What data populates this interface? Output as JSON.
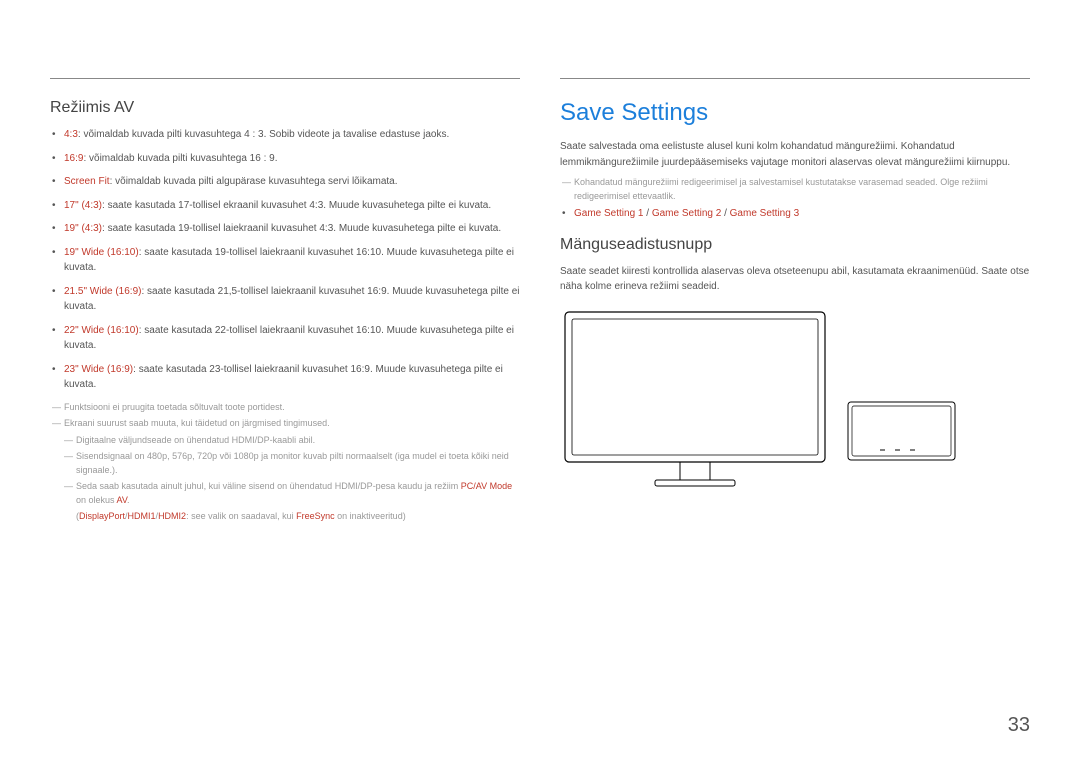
{
  "left": {
    "heading": "Režiimis AV",
    "bullets": [
      {
        "term": "4:3",
        "text": ": võimaldab kuvada pilti kuvasuhtega 4 : 3. Sobib videote ja tavalise edastuse jaoks."
      },
      {
        "term": "16:9",
        "text": ": võimaldab kuvada pilti kuvasuhtega 16 : 9."
      },
      {
        "term": "Screen Fit",
        "text": ": võimaldab kuvada pilti algupärase kuvasuhtega servi lõikamata."
      },
      {
        "term": "17\" (4:3)",
        "text": ": saate kasutada 17-tollisel ekraanil kuvasuhet 4:3. Muude kuvasuhetega pilte ei kuvata."
      },
      {
        "term": "19\" (4:3)",
        "text": ": saate kasutada 19-tollisel laiekraanil kuvasuhet 4:3. Muude kuvasuhetega pilte ei kuvata."
      },
      {
        "term": "19\" Wide (16:10)",
        "text": ": saate kasutada 19-tollisel laiekraanil kuvasuhet 16:10. Muude kuvasuhetega pilte ei kuvata."
      },
      {
        "term": "21.5\" Wide (16:9)",
        "text": ": saate kasutada 21,5-tollisel laiekraanil kuvasuhet 16:9. Muude kuvasuhetega pilte ei kuvata."
      },
      {
        "term": "22\" Wide (16:10)",
        "text": ": saate kasutada 22-tollisel laiekraanil kuvasuhet 16:10. Muude kuvasuhetega pilte ei kuvata."
      },
      {
        "term": "23\" Wide (16:9)",
        "text": ": saate kasutada 23-tollisel laiekraanil kuvasuhet 16:9. Muude kuvasuhetega pilte ei kuvata."
      }
    ],
    "note1": "Funktsiooni ei pruugita toetada sõltuvalt toote portidest.",
    "note2": "Ekraani suurust saab muuta, kui täidetud on järgmised tingimused.",
    "note2a": "Digitaalne väljundseade on ühendatud HDMI/DP-kaabli abil.",
    "note2b": "Sisendsignaal on 480p, 576p, 720p või 1080p ja monitor kuvab pilti normaalselt (iga mudel ei toeta kõiki neid signaale.).",
    "note2c_pre": "Seda saab kasutada ainult juhul, kui väline sisend on ühendatud HDMI/DP-pesa kaudu ja režiim ",
    "note2c_pcav": "PC/AV Mode",
    "note2c_mid": " on olekus ",
    "note2c_av": "AV",
    "note2c_post": ".",
    "note2d_open": "(",
    "note2d_dp": "DisplayPort",
    "note2d_h1": "HDMI1",
    "note2d_h2": "HDMI2",
    "note2d_mid": ": see valik on saadaval, kui ",
    "note2d_fs": "FreeSync",
    "note2d_end": " on inaktiveeritud)"
  },
  "right": {
    "heading": "Save Settings",
    "para1": "Saate salvestada oma eelistuste alusel kuni kolm kohandatud mängurežiimi. Kohandatud lemmikmängurežiimile juurdepääsemiseks vajutage monitori alaservas olevat mängurežiimi kiirnuppu.",
    "note": "Kohandatud mängurežiimi redigeerimisel ja salvestamisel kustutatakse varasemad seaded. Olge režiimi redigeerimisel ettevaatlik.",
    "bullet_gs1": "Game Setting 1",
    "bullet_sep": " / ",
    "bullet_gs2": "Game Setting 2",
    "bullet_gs3": "Game Setting 3",
    "sub_heading": "Mänguseadistusnupp",
    "para2": "Saate seadet kiiresti kontrollida alaservas oleva otseteenupu abil, kasutamata ekraanimenüüd. Saate otse näha kolme erineva režiimi seadeid."
  },
  "page_number": "33"
}
